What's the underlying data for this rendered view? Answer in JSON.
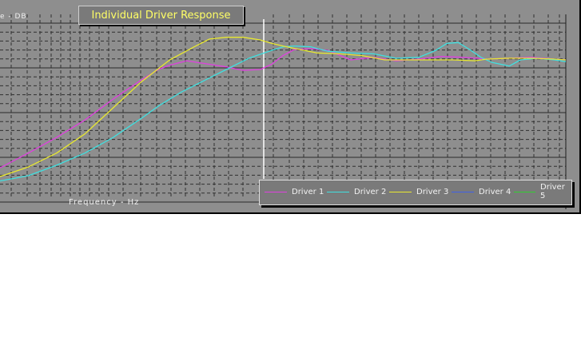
{
  "chart_data": {
    "type": "line",
    "title": "Individual Driver Response",
    "ylabel": "e - DB",
    "xlabel": "Frequency - Hz",
    "grid": true,
    "legend_placement": "bottom-right",
    "series": [
      {
        "name": "Driver 1",
        "color": "#e040e0",
        "x": [
          0,
          0.05,
          0.1,
          0.15,
          0.2,
          0.25,
          0.28,
          0.3,
          0.33,
          0.36,
          0.4,
          0.43,
          0.46,
          0.48,
          0.5,
          0.52,
          0.55,
          0.58,
          0.62,
          0.66,
          0.7,
          0.74,
          0.78,
          0.82,
          0.86,
          0.9,
          0.94,
          0.98,
          1.0
        ],
        "y": [
          0.155,
          0.24,
          0.33,
          0.43,
          0.55,
          0.66,
          0.72,
          0.745,
          0.77,
          0.755,
          0.735,
          0.715,
          0.72,
          0.75,
          0.8,
          0.835,
          0.84,
          0.83,
          0.775,
          0.79,
          0.77,
          0.78,
          0.795,
          0.79,
          0.78,
          0.785,
          0.79,
          0.78,
          0.775
        ]
      },
      {
        "name": "Driver 2",
        "color": "#40e0e0",
        "x": [
          0,
          0.05,
          0.1,
          0.15,
          0.2,
          0.25,
          0.28,
          0.32,
          0.36,
          0.4,
          0.44,
          0.48,
          0.5,
          0.52,
          0.55,
          0.58,
          0.62,
          0.66,
          0.7,
          0.74,
          0.77,
          0.79,
          0.81,
          0.83,
          0.85,
          0.87,
          0.9,
          0.92,
          0.95,
          0.98,
          1.0
        ],
        "y": [
          0.08,
          0.11,
          0.17,
          0.24,
          0.33,
          0.44,
          0.51,
          0.59,
          0.655,
          0.72,
          0.785,
          0.83,
          0.85,
          0.855,
          0.85,
          0.825,
          0.815,
          0.81,
          0.785,
          0.79,
          0.83,
          0.87,
          0.875,
          0.835,
          0.79,
          0.76,
          0.74,
          0.775,
          0.785,
          0.775,
          0.765
        ]
      },
      {
        "name": "Driver 3",
        "color": "#e8e830",
        "x": [
          0,
          0.05,
          0.1,
          0.15,
          0.2,
          0.25,
          0.3,
          0.34,
          0.37,
          0.4,
          0.43,
          0.46,
          0.48,
          0.5,
          0.53,
          0.56,
          0.6,
          0.64,
          0.68,
          0.72,
          0.76,
          0.8,
          0.84,
          0.86,
          0.9,
          0.94,
          0.98,
          1.0
        ],
        "y": [
          0.105,
          0.16,
          0.24,
          0.35,
          0.5,
          0.65,
          0.775,
          0.845,
          0.895,
          0.905,
          0.905,
          0.89,
          0.87,
          0.855,
          0.835,
          0.815,
          0.81,
          0.8,
          0.775,
          0.775,
          0.775,
          0.775,
          0.77,
          0.78,
          0.785,
          0.785,
          0.78,
          0.775
        ]
      },
      {
        "name": "Driver 4",
        "color": "#4060e8",
        "x": [],
        "y": []
      },
      {
        "name": "Driver 5",
        "color": "#30d030",
        "x": [],
        "y": []
      }
    ]
  }
}
